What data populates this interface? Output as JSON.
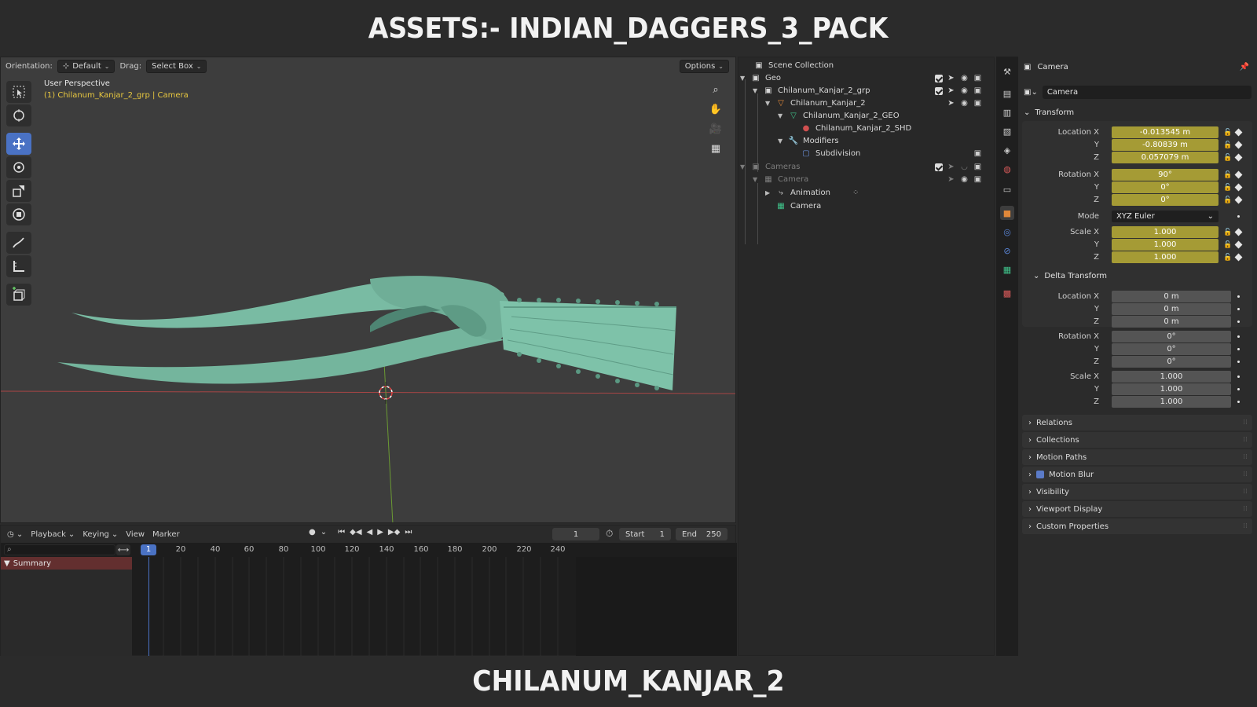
{
  "banner": {
    "top": "ASSETS:- INDIAN_DAGGERS_3_PACK",
    "bottom": "CHILANUM_KANJAR_2"
  },
  "viewport": {
    "orientation_label": "Orientation:",
    "orientation_value": "Default",
    "drag_label": "Drag:",
    "drag_value": "Select Box",
    "options_label": "Options",
    "view_title": "User Perspective",
    "view_subtitle": "(1) Chilanum_Kanjar_2_grp | Camera",
    "model_color": "#7bbfa6"
  },
  "timeline": {
    "menus": [
      "Playback",
      "Keying",
      "View",
      "Marker"
    ],
    "current_frame": "1",
    "start_label": "Start",
    "start_value": "1",
    "end_label": "End",
    "end_value": "250",
    "ruler_ticks": [
      "20",
      "40",
      "60",
      "80",
      "100",
      "120",
      "140",
      "160",
      "180",
      "200",
      "220",
      "240"
    ],
    "ruler_current": "1",
    "summary_label": "Summary"
  },
  "outliner": {
    "root": "Scene Collection",
    "items": [
      {
        "label": "Geo",
        "icon": "collection-icon"
      },
      {
        "label": "Chilanum_Kanjar_2_grp",
        "icon": "collection-icon"
      },
      {
        "label": "Chilanum_Kanjar_2",
        "icon": "mesh-object-icon"
      },
      {
        "label": "Chilanum_Kanjar_2_GEO",
        "icon": "mesh-data-icon"
      },
      {
        "label": "Chilanum_Kanjar_2_SHD",
        "icon": "material-icon"
      },
      {
        "label": "Modifiers",
        "icon": "wrench-icon"
      },
      {
        "label": "Subdivision",
        "icon": "subdivision-icon"
      },
      {
        "label": "Cameras",
        "icon": "collection-icon"
      },
      {
        "label": "Camera",
        "icon": "camera-object-icon"
      },
      {
        "label": "Animation",
        "icon": "animation-icon"
      },
      {
        "label": "Camera",
        "icon": "camera-data-icon"
      }
    ]
  },
  "properties": {
    "header": "Camera",
    "object_name": "Camera",
    "transform": {
      "title": "Transform",
      "location_label": "Location X",
      "location": [
        "-0.013545 m",
        "-0.80839 m",
        "0.057079 m"
      ],
      "rotation_label": "Rotation X",
      "rotation": [
        "90°",
        "0°",
        "0°"
      ],
      "mode_label": "Mode",
      "mode_value": "XYZ Euler",
      "scale_label": "Scale X",
      "scale": [
        "1.000",
        "1.000",
        "1.000"
      ],
      "y_label": "Y",
      "z_label": "Z"
    },
    "delta": {
      "title": "Delta Transform",
      "location_label": "Location X",
      "location": [
        "0 m",
        "0 m",
        "0 m"
      ],
      "rotation_label": "Rotation X",
      "rotation": [
        "0°",
        "0°",
        "0°"
      ],
      "scale_label": "Scale X",
      "scale": [
        "1.000",
        "1.000",
        "1.000"
      ]
    },
    "panels": [
      "Relations",
      "Collections",
      "Motion Paths",
      "Motion Blur",
      "Visibility",
      "Viewport Display",
      "Custom Properties"
    ]
  }
}
